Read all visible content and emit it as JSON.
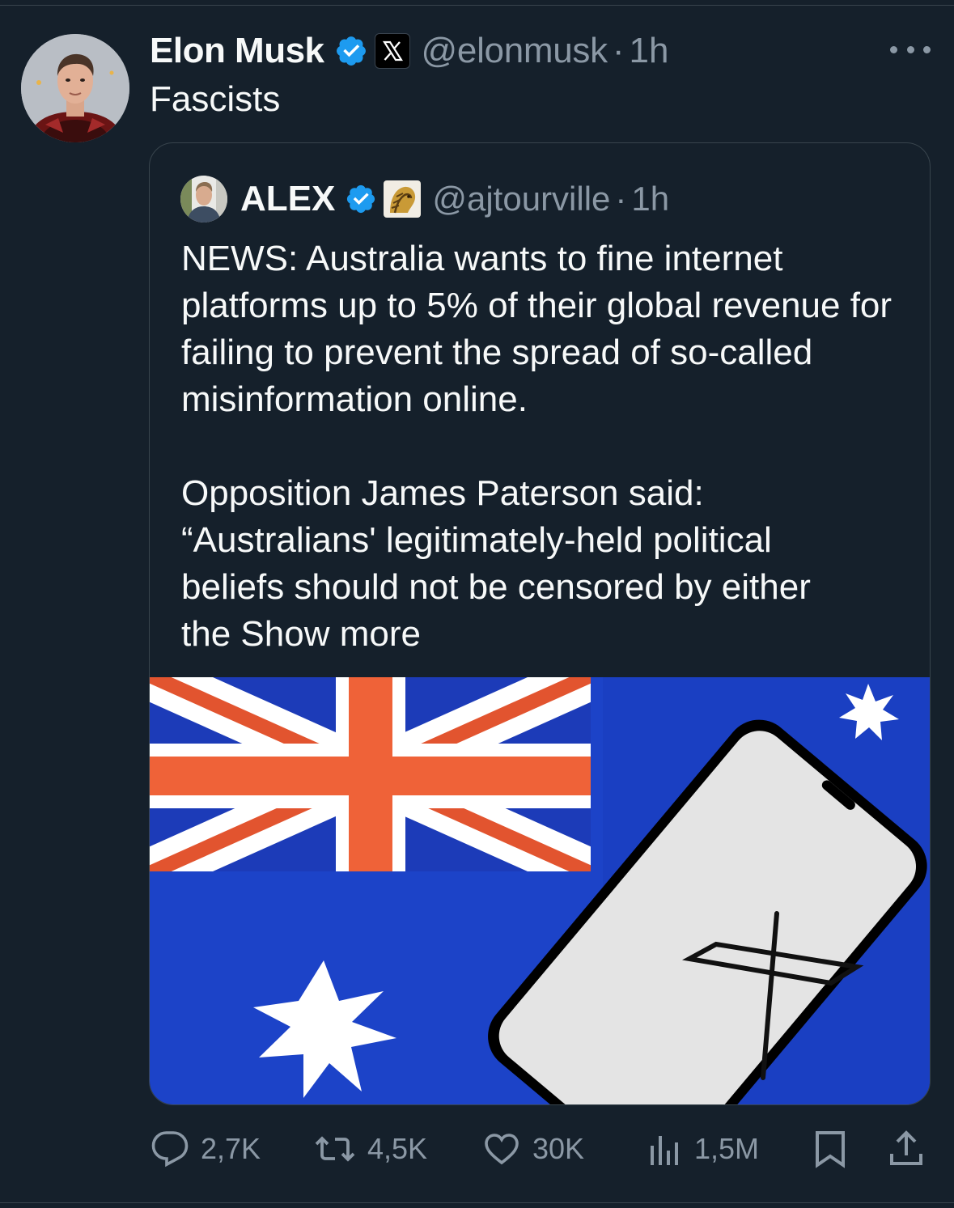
{
  "post": {
    "author_name": "Elon Musk",
    "handle": "@elonmusk",
    "separator": "·",
    "time": "1h",
    "text": "Fascists"
  },
  "quoted": {
    "author_name": "ALEX",
    "handle": "@ajtourville",
    "separator": "·",
    "time": "1h",
    "paragraph_1": "NEWS: Australia wants to fine internet platforms up to 5% of their global revenue for failing to prevent the spread of so-called misinformation online.",
    "paragraph_2_lines": [
      "Opposition James Paterson said:",
      "“Australians' legitimately-held political",
      "beliefs should not be censored by either",
      "the"
    ],
    "show_more": "Show more"
  },
  "actions": {
    "replies": "2,7K",
    "reposts": "4,5K",
    "likes": "30K",
    "views": "1,5M"
  },
  "colors": {
    "background": "#15202b",
    "text": "#f7f9f9",
    "muted": "#8b98a5",
    "border": "#38444d",
    "verified_blue": "#1d9bf0"
  },
  "icons": {
    "verified": "verified-badge-icon",
    "affiliate_x": "x-logo-icon",
    "affiliate_lion": "lion-logo-icon",
    "more": "more-dots-icon",
    "reply": "reply-icon",
    "repost": "repost-icon",
    "like": "heart-icon",
    "views": "views-chart-icon",
    "bookmark": "bookmark-icon",
    "share": "share-icon"
  }
}
